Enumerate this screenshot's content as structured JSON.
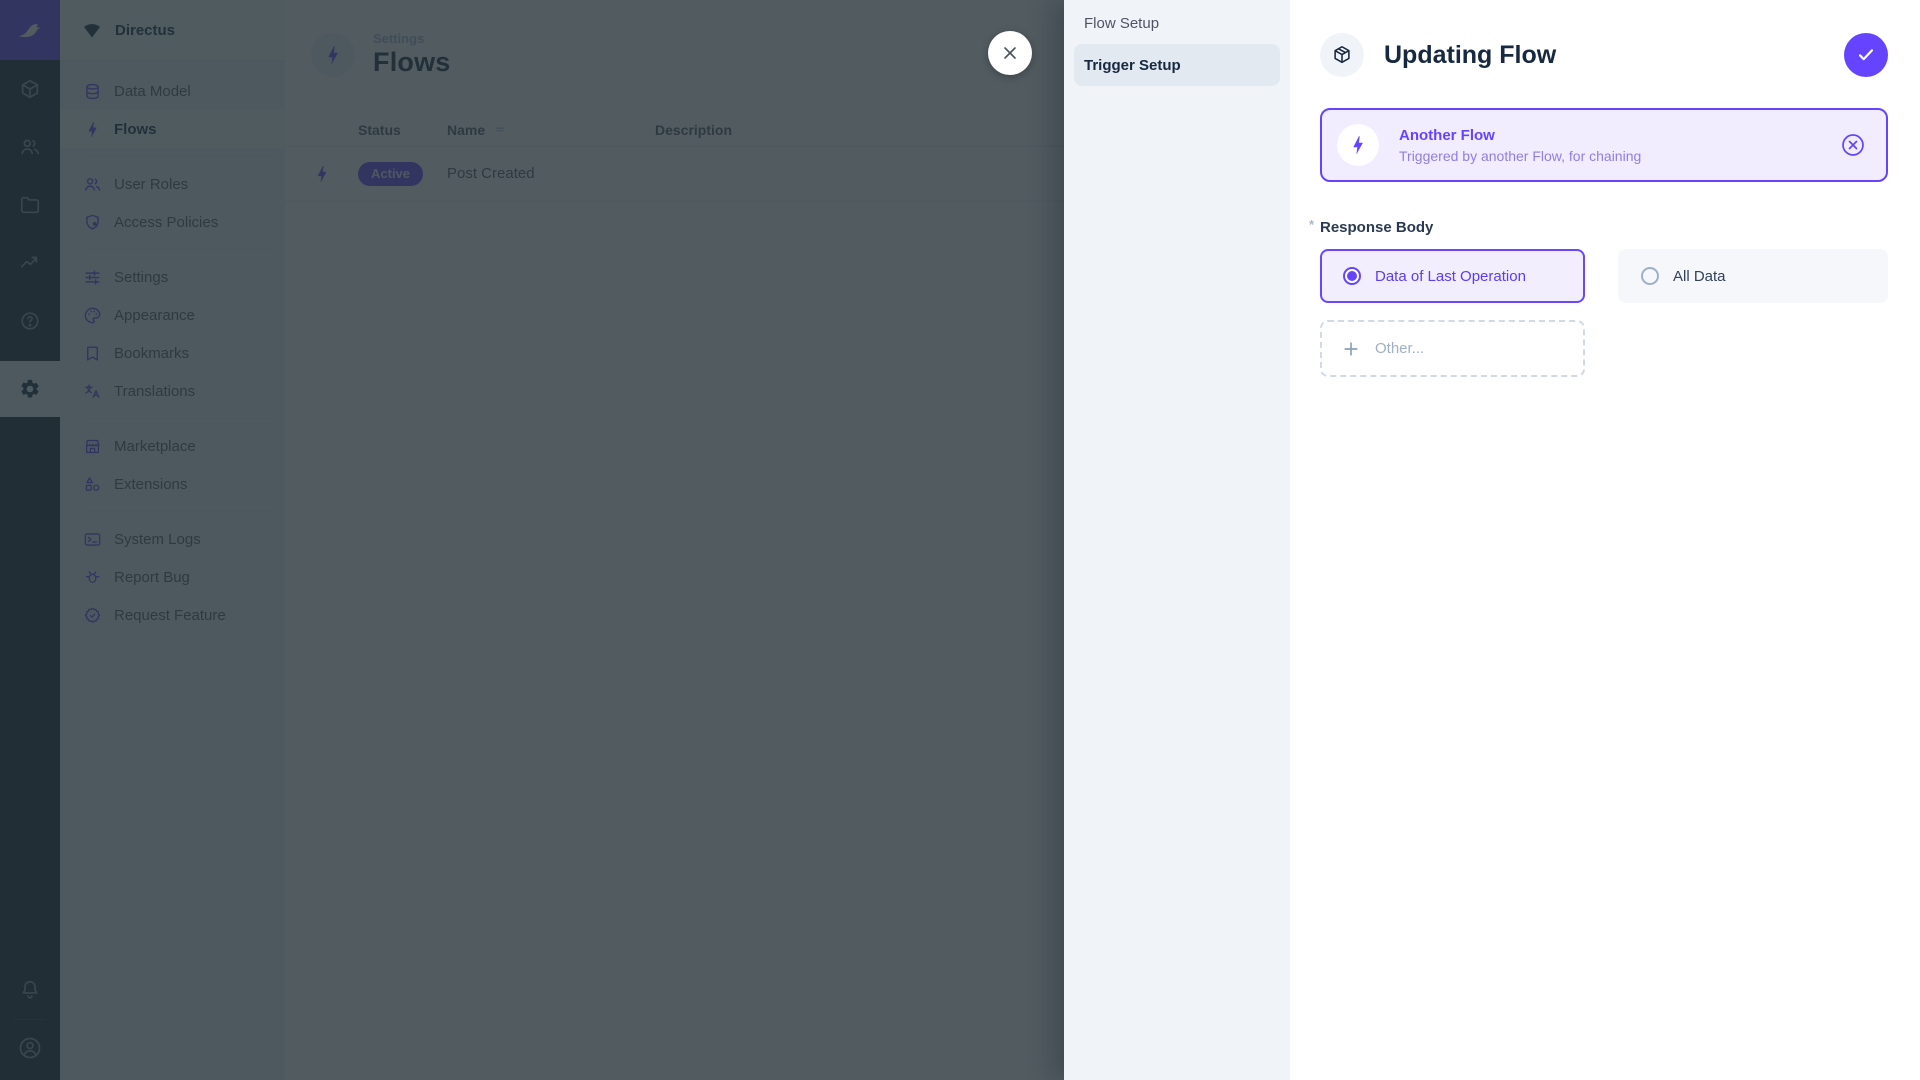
{
  "colors": {
    "primary": "#6644ff",
    "overlay": "rgba(38,50,56,0.8)",
    "nav_background": "#f0f4f9",
    "module_bar_background": "#18222f"
  },
  "project": {
    "name": "Directus"
  },
  "module_bar": {
    "icons": [
      "box",
      "people",
      "folder",
      "monitoring",
      "help",
      "settings"
    ],
    "footer_icons": [
      "notifications",
      "account"
    ]
  },
  "nav": {
    "items": [
      {
        "label": "Data Model",
        "icon": "database"
      },
      {
        "label": "Flows",
        "icon": "bolt",
        "active": true
      },
      {
        "label": "User Roles",
        "icon": "people"
      },
      {
        "label": "Access Policies",
        "icon": "shield-lock"
      },
      {
        "label": "Settings",
        "icon": "tune"
      },
      {
        "label": "Appearance",
        "icon": "palette"
      },
      {
        "label": "Bookmarks",
        "icon": "bookmark"
      },
      {
        "label": "Translations",
        "icon": "translate"
      },
      {
        "label": "Marketplace",
        "icon": "storefront"
      },
      {
        "label": "Extensions",
        "icon": "shapes"
      },
      {
        "label": "System Logs",
        "icon": "terminal"
      },
      {
        "label": "Report Bug",
        "icon": "bug"
      },
      {
        "label": "Request Feature",
        "icon": "new-releases"
      }
    ]
  },
  "page": {
    "breadcrumb": "Settings",
    "title": "Flows"
  },
  "table": {
    "columns": [
      "Status",
      "Name",
      "Description"
    ],
    "rows": [
      {
        "status": "Active",
        "name": "Post Created",
        "description": ""
      }
    ]
  },
  "drawer": {
    "nav": [
      {
        "label": "Flow Setup"
      },
      {
        "label": "Trigger Setup",
        "active": true
      }
    ],
    "title": "Updating Flow",
    "trigger_card": {
      "title": "Another Flow",
      "subtitle": "Triggered by another Flow, for chaining"
    },
    "field": {
      "label": "Response Body",
      "required_marker": "*"
    },
    "options": [
      {
        "label": "Data of Last Operation",
        "selected": true
      },
      {
        "label": "All Data",
        "selected": false
      }
    ],
    "other_label": "Other..."
  }
}
